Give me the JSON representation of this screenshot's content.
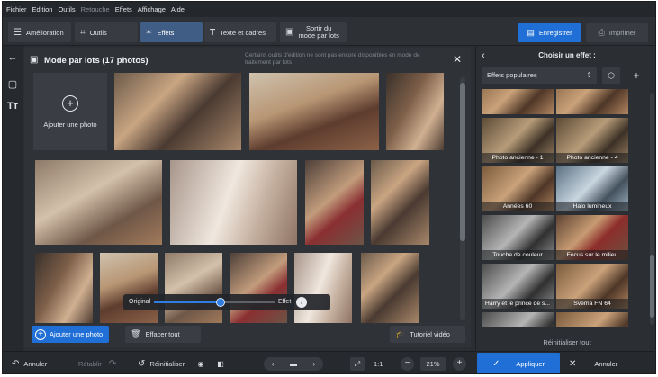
{
  "menu": [
    "Fichier",
    "Edition",
    "Outils",
    "Retouche",
    "Effets",
    "Affichage",
    "Aide"
  ],
  "menu_dim_index": 3,
  "toolbar": {
    "tabs": [
      {
        "label": "Amélioration",
        "icon": "sliders-icon"
      },
      {
        "label": "Outils",
        "icon": "crop-icon"
      },
      {
        "label": "Effets",
        "icon": "sparkle-icon",
        "active": true
      },
      {
        "label": "Texte et cadres",
        "icon": "text-icon"
      }
    ],
    "batch_exit_line1": "Sortir du",
    "batch_exit_line2": "mode par lots",
    "save_label": "Enregistrer",
    "print_label": "Imprimer"
  },
  "batch": {
    "title": "Mode par lots (17 photos)",
    "note": "Certains outils d'édition ne sont pas encore disponibles en mode de traitement par lots",
    "add_tile_label": "Ajouter une photo",
    "slider": {
      "left_label": "Original",
      "right_label": "Effet",
      "value": 0.55
    },
    "add_photo_label": "Ajouter une photo",
    "clear_label": "Effacer tout",
    "tutorial_label": "Tutoriel vidéo"
  },
  "right_panel": {
    "title": "Choisir un effet :",
    "category": "Effets populaires",
    "effects": [
      {
        "label": "",
        "tone": "warm"
      },
      {
        "label": "",
        "tone": "warm"
      },
      {
        "label": "Photo ancienne - 1",
        "tone": "sepia"
      },
      {
        "label": "Photo ancienne - 4",
        "tone": "sepia"
      },
      {
        "label": "Années 60",
        "tone": "warm"
      },
      {
        "label": "Halo lumineux",
        "tone": "cool"
      },
      {
        "label": "Touche de couleur",
        "tone": "gray"
      },
      {
        "label": "Focus sur le milieu",
        "tone": "natural"
      },
      {
        "label": "Harry et le prince de s...",
        "tone": "gray"
      },
      {
        "label": "Svema FN 64",
        "tone": "warm"
      },
      {
        "label": "",
        "tone": "gray"
      },
      {
        "label": "",
        "tone": "warm"
      }
    ],
    "reset_all": "Réinitialiser tout",
    "apply_label": "Appliquer",
    "cancel_label": "Annuler"
  },
  "bottom": {
    "undo": "Annuler",
    "redo": "Rétablir",
    "reset": "Réinitialiser",
    "ratio": "1:1",
    "zoom": "21%"
  },
  "colors": {
    "accent": "#1f6fd6",
    "panel": "#2b2e33"
  }
}
